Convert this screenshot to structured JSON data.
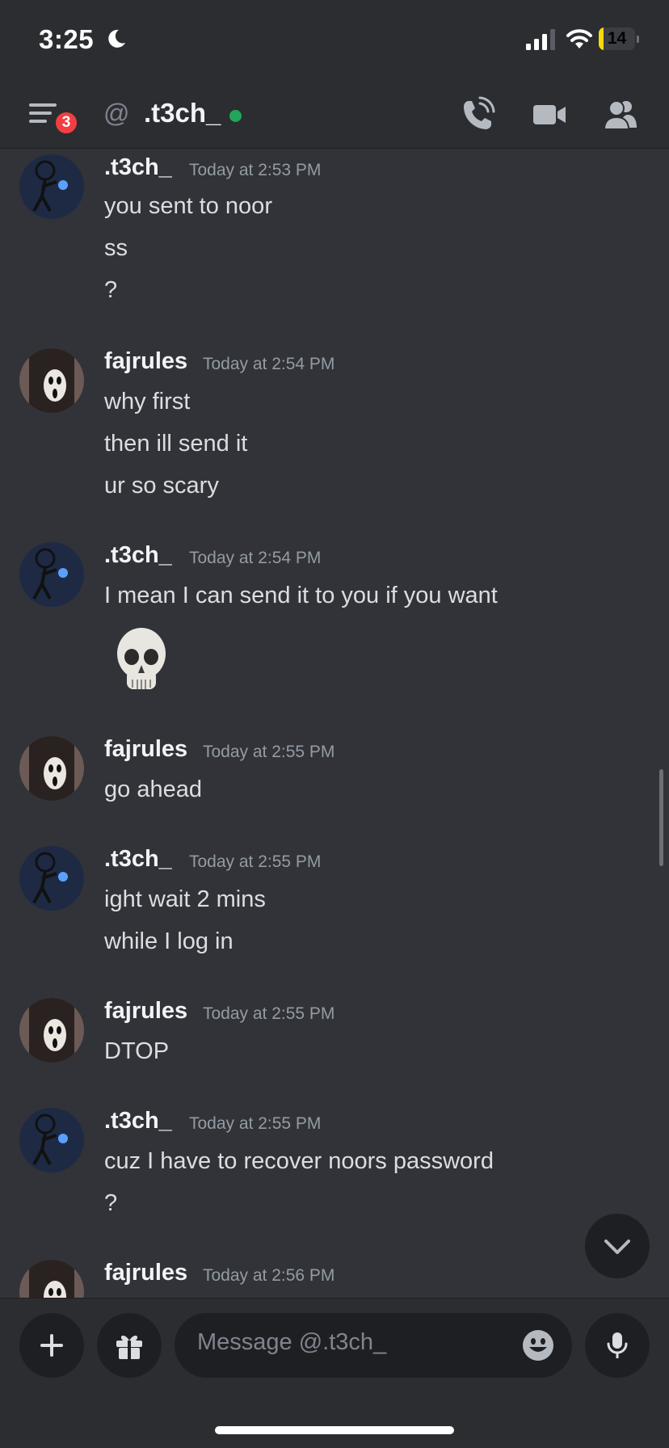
{
  "status_bar": {
    "time": "3:25",
    "battery": "14",
    "battery_level_percent": 14
  },
  "header": {
    "badge_count": "3",
    "at_symbol": "@",
    "channel_name": ".t3ch_"
  },
  "messages": [
    {
      "username": ".t3ch_",
      "timestamp": "Today at 2:53 PM",
      "lines": [
        "you sent to noor",
        "ss",
        "?"
      ]
    },
    {
      "username": "fajrules",
      "timestamp": "Today at 2:54 PM",
      "lines": [
        "why first",
        "then ill send it",
        "ur so scary"
      ]
    },
    {
      "username": ".t3ch_",
      "timestamp": "Today at 2:54 PM",
      "lines": [
        "I mean I can send it to you if you want"
      ],
      "emoji": "skull-emoji"
    },
    {
      "username": "fajrules",
      "timestamp": "Today at 2:55 PM",
      "lines": [
        "go ahead"
      ]
    },
    {
      "username": ".t3ch_",
      "timestamp": "Today at 2:55 PM",
      "lines": [
        "ight wait 2 mins",
        "while I log in"
      ]
    },
    {
      "username": "fajrules",
      "timestamp": "Today at 2:55 PM",
      "lines": [
        "DTOP"
      ]
    },
    {
      "username": ".t3ch_",
      "timestamp": "Today at 2:55 PM",
      "lines": [
        "cuz I have to recover noors password",
        "?"
      ]
    },
    {
      "username": "fajrules",
      "timestamp": "Today at 2:56 PM",
      "lines": []
    }
  ],
  "composer": {
    "placeholder": "Message @.t3ch_"
  },
  "icons": {
    "menu": "hamburger-icon",
    "call": "phone-icon",
    "video": "video-camera-icon",
    "members": "members-icon",
    "add": "plus-icon",
    "gift": "gift-icon",
    "emoji": "smiley-icon",
    "mic": "microphone-icon",
    "jump": "chevron-down-icon"
  },
  "colors": {
    "background": "#313338",
    "header": "#2b2d31",
    "online": "#23a55a",
    "badge": "#f23f43",
    "battery": "#f5d90a"
  }
}
